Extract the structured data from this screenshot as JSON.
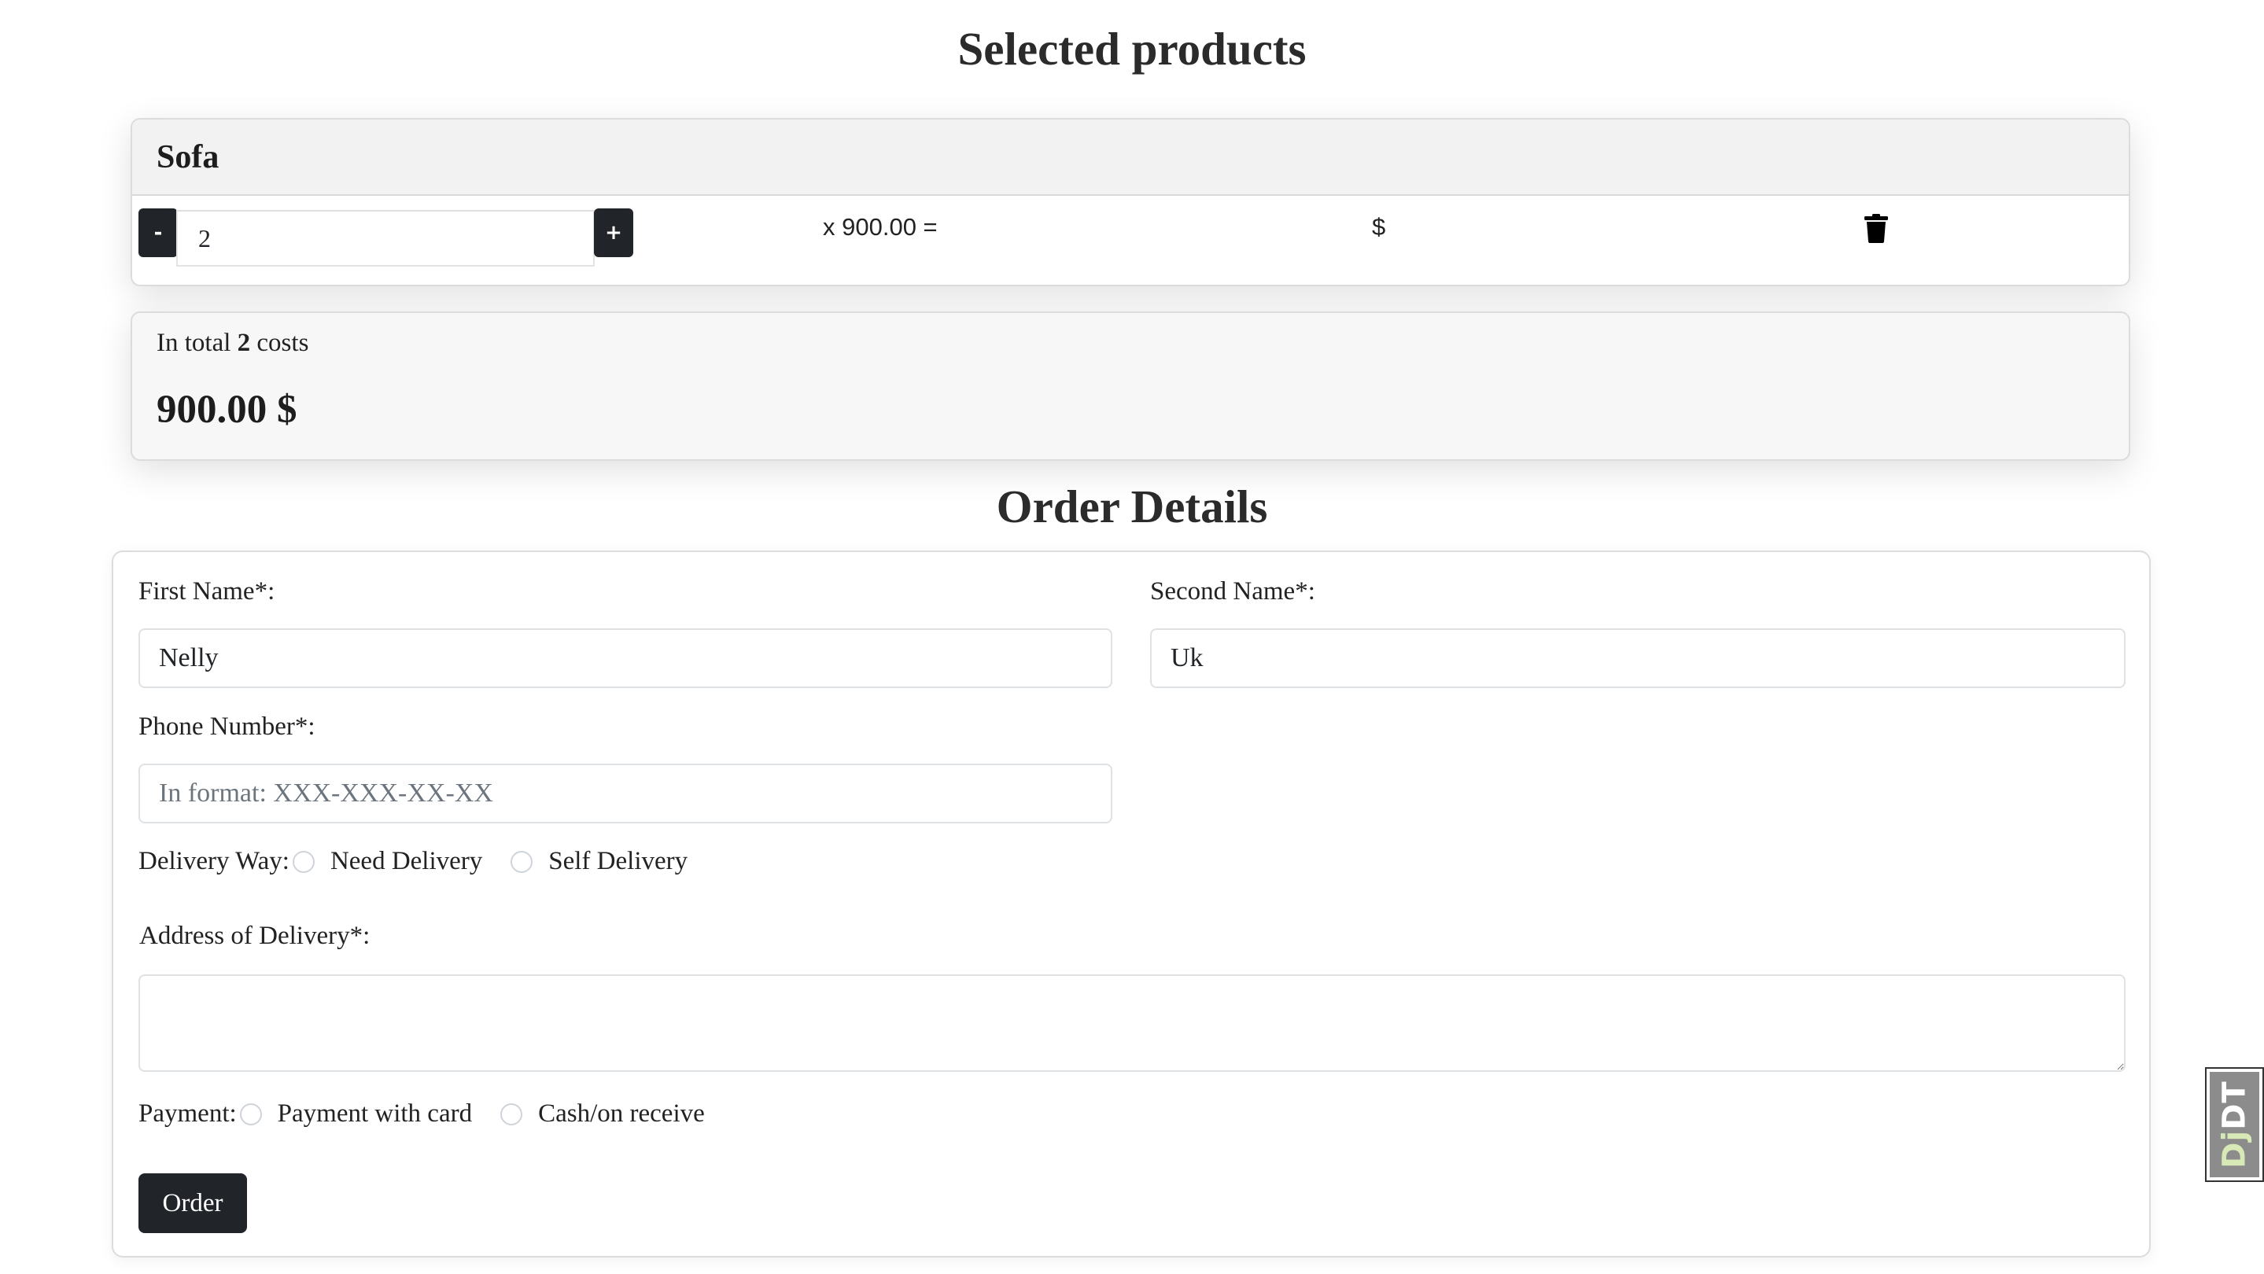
{
  "page": {
    "selected_title": "Selected products",
    "order_title": "Order Details"
  },
  "cart": {
    "items": [
      {
        "name": "Sofa",
        "quantity": "2",
        "minus_label": "-",
        "plus_label": "+",
        "unit_price_text": "x 900.00 =",
        "line_total_text": "$",
        "delete_icon": "trash-icon"
      }
    ],
    "total": {
      "prefix": "In total",
      "count": "2",
      "suffix": "costs",
      "sum": "900.00 $"
    }
  },
  "form": {
    "first_name": {
      "label": "First Name*:",
      "value": "Nelly"
    },
    "second_name": {
      "label": "Second Name*:",
      "value": "Uk"
    },
    "phone": {
      "label": "Phone Number*:",
      "value": "",
      "placeholder": "In format: XXX-XXX-XX-XX"
    },
    "delivery": {
      "label": "Delivery Way:",
      "options": [
        "Need Delivery",
        "Self Delivery"
      ]
    },
    "address": {
      "label": "Address of Delivery*:",
      "value": ""
    },
    "payment": {
      "label": "Payment:",
      "options": [
        "Payment with card",
        "Cash/on receive"
      ]
    },
    "submit_label": "Order"
  },
  "debug_toolbar": {
    "handle_prefix": "Dj",
    "handle_suffix": "DT"
  },
  "colors": {
    "dark_button": "#212529",
    "header_bg": "#f2f2f3",
    "total_bg": "#f7f7f7"
  }
}
